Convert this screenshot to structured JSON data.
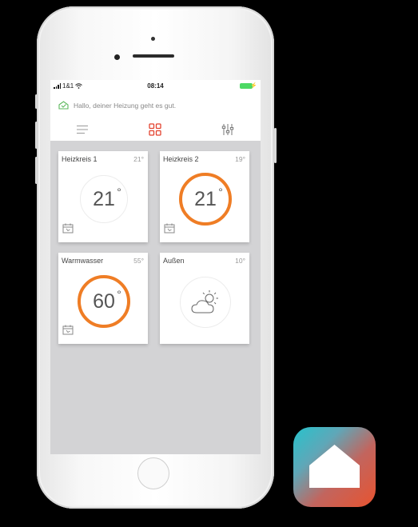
{
  "status_bar": {
    "carrier": "1&1",
    "time": "08:14",
    "battery_color": "#4cd964"
  },
  "header": {
    "greeting": "Hallo, deiner Heizung geht es gut.",
    "greeting_icon": "house-check-icon",
    "nav": [
      {
        "icon": "menu-icon"
      },
      {
        "icon": "grid-icon",
        "active": true
      },
      {
        "icon": "sliders-icon"
      }
    ],
    "accent": "#e3422e"
  },
  "tiles": [
    {
      "name": "Heizkreis 1",
      "value": "21°",
      "display": "21",
      "state": "idle",
      "icon": "calendar-clock-icon"
    },
    {
      "name": "Heizkreis 2",
      "value": "19°",
      "display": "21",
      "state": "heating",
      "icon": "calendar-clock-icon"
    },
    {
      "name": "Warmwasser",
      "value": "55°",
      "display": "60",
      "state": "heating",
      "icon": "calendar-clock-icon"
    },
    {
      "name": "Außen",
      "value": "10°",
      "display_icon": "partly-cloudy-icon"
    }
  ],
  "degree_symbol": "°",
  "colors": {
    "heating_ring": "#ef7d25",
    "screen_bg": "#d3d3d5"
  },
  "app_icon": {
    "icon": "home-icon"
  }
}
